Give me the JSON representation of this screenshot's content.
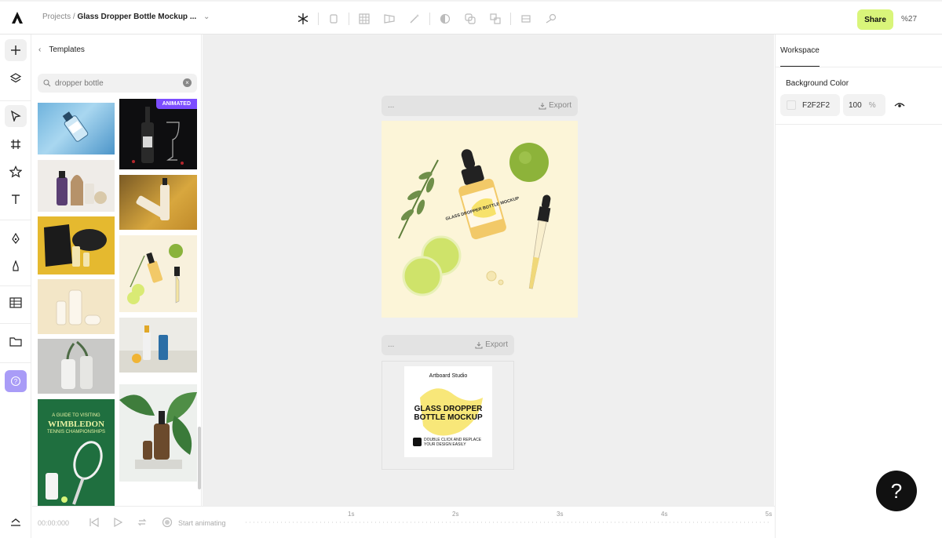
{
  "topbar": {
    "breadcrumb_root": "Projects /",
    "breadcrumb_current": "Glass Dropper Bottle Mockup ...",
    "share_label": "Share",
    "zoom": "%27"
  },
  "templates_panel": {
    "title": "Templates",
    "search_value": "dropper bottle",
    "badge": "ANIMATED"
  },
  "canvas": {
    "artboard1": {
      "name": "...",
      "export_label": "Export",
      "preview_label": "GLASS DROPPER BOTTLE MOCKUP"
    },
    "artboard2": {
      "name": "...",
      "export_label": "Export",
      "card_brand": "Artboard Studio",
      "card_title_line1": "GLASS DROPPER",
      "card_title_line2": "BOTTLE MOCKUP",
      "card_footer_line1": "DOUBLE CLICK AND REPLACE",
      "card_footer_line2": "YOUR DESIGN EASILY"
    }
  },
  "template_texts": {
    "wimbledon_line1": "A GUIDE TO VISITING",
    "wimbledon_line2": "WIMBLEDON",
    "wimbledon_line3": "TENNIS CHAMPIONSHIPS"
  },
  "right_panel": {
    "tab": "Workspace",
    "background_label": "Background Color",
    "color_value": "F2F2F2",
    "opacity_value": "100",
    "opacity_unit": "%"
  },
  "help_label": "?",
  "timeline": {
    "time": "00:00:000",
    "start_label": "Start animating",
    "ticks": [
      "1s",
      "2s",
      "3s",
      "4s",
      "5s"
    ]
  },
  "colors": {
    "accent_share": "#d9f57a",
    "badge": "#7c4dff",
    "help": "#111111"
  }
}
